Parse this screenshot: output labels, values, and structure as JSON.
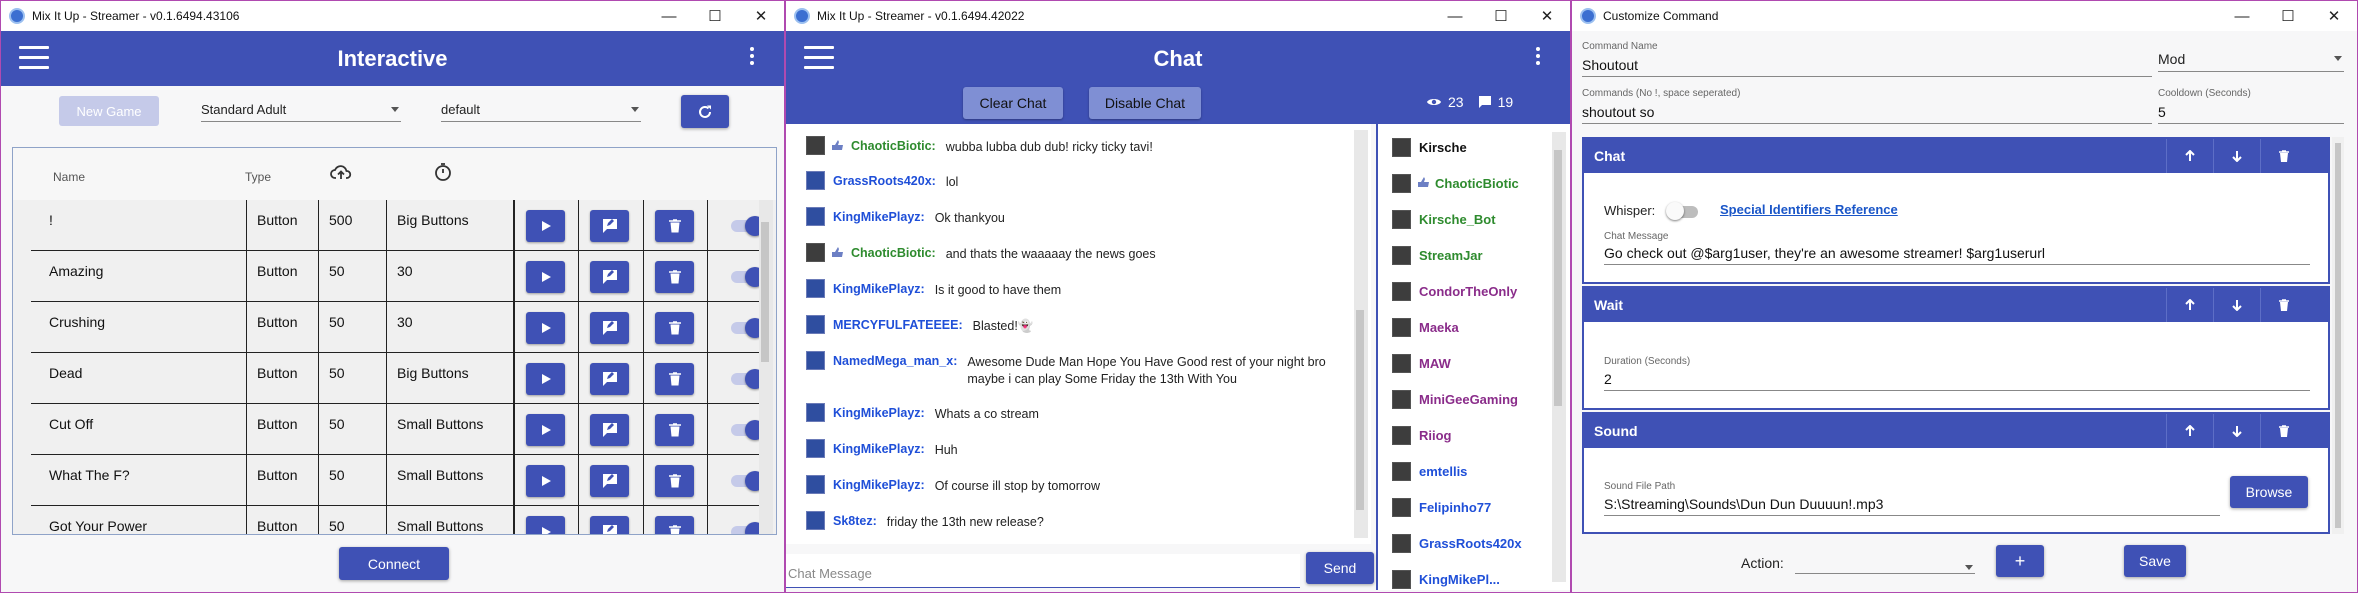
{
  "windows": {
    "interactive": {
      "title": "Mix It Up - Streamer - v0.1.6494.43106",
      "header": "Interactive",
      "new_game_label": "New Game",
      "scene_select": "Standard Adult",
      "group_select": "default",
      "columns": {
        "name": "Name",
        "type": "Type",
        "cost_icon": "cloud-upload-icon",
        "cooldown_icon": "timer-icon"
      },
      "rows": [
        {
          "name": "!",
          "type": "Button",
          "cost": "500",
          "cooldown": "Big Buttons"
        },
        {
          "name": "Amazing",
          "type": "Button",
          "cost": "50",
          "cooldown": "30"
        },
        {
          "name": "Crushing",
          "type": "Button",
          "cost": "50",
          "cooldown": "30"
        },
        {
          "name": "Dead",
          "type": "Button",
          "cost": "50",
          "cooldown": "Big Buttons"
        },
        {
          "name": "Cut Off",
          "type": "Button",
          "cost": "50",
          "cooldown": "Small Buttons"
        },
        {
          "name": "What The F?",
          "type": "Button",
          "cost": "50",
          "cooldown": "Small Buttons"
        },
        {
          "name": "Got Your Power",
          "type": "Button",
          "cost": "50",
          "cooldown": "Small Buttons"
        }
      ],
      "connect_label": "Connect"
    },
    "chat": {
      "title": "Mix It Up - Streamer - v0.1.6494.42022",
      "header": "Chat",
      "clear_label": "Clear Chat",
      "disable_label": "Disable Chat",
      "viewers": "23",
      "chatters": "19",
      "messages": [
        {
          "user": "ChaoticBiotic",
          "text": "wubba lubba dub dub! ricky ticky tavi!",
          "color": "#2e8b2e"
        },
        {
          "user": "GrassRoots420x",
          "text": "lol",
          "color": "#1f4fd8"
        },
        {
          "user": "KingMikePlayz",
          "text": "Ok thankyou",
          "color": "#1f4fd8"
        },
        {
          "user": "ChaoticBiotic",
          "text": "and thats the waaaaay the news goes",
          "color": "#2e8b2e"
        },
        {
          "user": "KingMikePlayz",
          "text": "Is it good to have them",
          "color": "#1f4fd8"
        },
        {
          "user": "MERCYFULFATEEEE",
          "text": "Blasted!👻",
          "color": "#1f4fd8"
        },
        {
          "user": "NamedMega_man_x",
          "text": "Awesome Dude Man Hope You Have Good rest of your night bro maybe i can play Some Friday the 13th With You",
          "color": "#1f4fd8"
        },
        {
          "user": "KingMikePlayz",
          "text": "Whats a co stream",
          "color": "#1f4fd8"
        },
        {
          "user": "KingMikePlayz",
          "text": "Huh",
          "color": "#1f4fd8"
        },
        {
          "user": "KingMikePlayz",
          "text": "Of course ill stop by tomorrow",
          "color": "#1f4fd8"
        },
        {
          "user": "Sk8tez",
          "text": "friday the 13th new release?",
          "color": "#1f4fd8"
        }
      ],
      "users": [
        {
          "name": "Kirsche",
          "color": "#111111"
        },
        {
          "name": "ChaoticBiotic",
          "color": "#2e8b2e"
        },
        {
          "name": "Kirsche_Bot",
          "color": "#2e8b2e"
        },
        {
          "name": "StreamJar",
          "color": "#2e8b2e"
        },
        {
          "name": "CondorTheOnly",
          "color": "#8a2c8a"
        },
        {
          "name": "Maeka",
          "color": "#8a2c8a"
        },
        {
          "name": "MAW",
          "color": "#8a2c8a"
        },
        {
          "name": "MiniGeeGaming",
          "color": "#8a2c8a"
        },
        {
          "name": "Riiog",
          "color": "#8a2c8a"
        },
        {
          "name": "emtellis",
          "color": "#1f4fd8"
        },
        {
          "name": "Felipinho77",
          "color": "#1f4fd8"
        },
        {
          "name": "GrassRoots420x",
          "color": "#1f4fd8"
        },
        {
          "name": "KingMikePl...",
          "color": "#1f4fd8"
        }
      ],
      "input_placeholder": "Chat Message",
      "send_label": "Send"
    },
    "customize": {
      "title": "Customize Command",
      "command_name_label": "Command Name",
      "command_name": "Shoutout",
      "permission": "Mod",
      "commands_label": "Commands (No !, space seperated)",
      "commands": "shoutout so",
      "cooldown_label": "Cooldown (Seconds)",
      "cooldown": "5",
      "chat_section": {
        "title": "Chat",
        "whisper_label": "Whisper:",
        "link": "Special Identifiers Reference",
        "msg_label": "Chat Message",
        "msg": "Go check out @$arg1user, they're an awesome streamer! $arg1userurl"
      },
      "wait_section": {
        "title": "Wait",
        "duration_label": "Duration (Seconds)",
        "duration": "2"
      },
      "sound_section": {
        "title": "Sound",
        "path_label": "Sound File Path",
        "path": "S:\\Streaming\\Sounds\\Dun Dun Duuuun!.mp3",
        "browse_label": "Browse"
      },
      "action_label": "Action:",
      "add_label": "+",
      "save_label": "Save"
    }
  },
  "colors": {
    "primary": "#3f51b5",
    "disabled": "#c5cae9",
    "frame": "#b04ab0"
  }
}
